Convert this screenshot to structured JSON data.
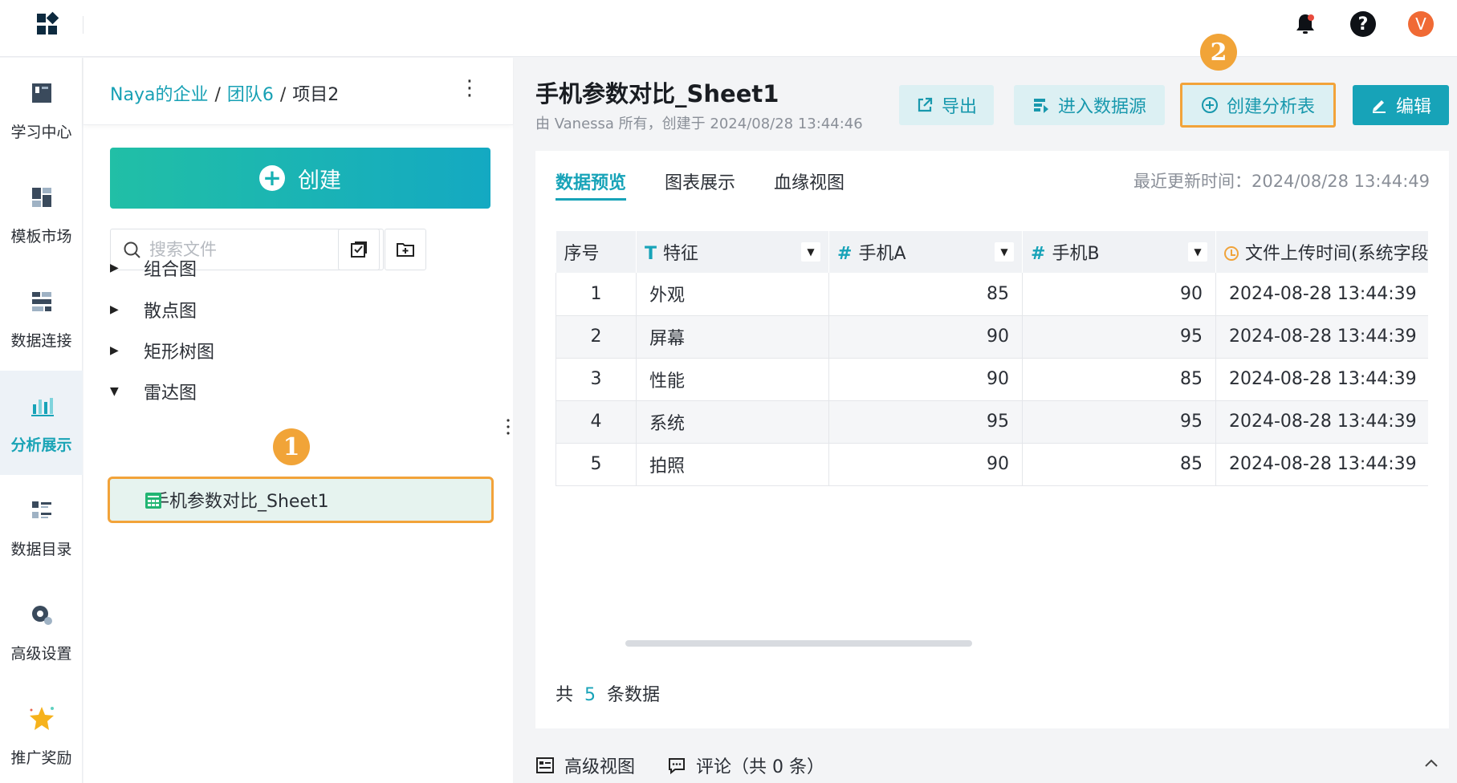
{
  "nav": {
    "items": [
      {
        "label": "学习中心",
        "icon": "book-icon"
      },
      {
        "label": "模板市场",
        "icon": "template-grid-icon"
      },
      {
        "label": "数据连接",
        "icon": "data-connect-icon"
      },
      {
        "label": "分析展示",
        "icon": "bar-chart-icon"
      },
      {
        "label": "数据目录",
        "icon": "catalog-icon"
      },
      {
        "label": "高级设置",
        "icon": "gear-icon"
      },
      {
        "label": "推广奖励",
        "icon": "star-icon"
      }
    ],
    "active": "分析展示"
  },
  "topbar": {
    "avatar_letter": "V"
  },
  "explorer": {
    "breadcrumb": [
      {
        "label": "Naya的企业"
      },
      {
        "label": "团队6"
      },
      {
        "label": "项目2"
      }
    ],
    "separator": "/",
    "more": "⋮",
    "create_label": "创建",
    "search_placeholder": "搜索文件",
    "tree": [
      {
        "label": "组合图",
        "arrow": "▶"
      },
      {
        "label": "散点图",
        "arrow": "▶"
      },
      {
        "label": "矩形树图",
        "arrow": "▶"
      },
      {
        "label": "雷达图",
        "arrow": "▼"
      }
    ],
    "selected_file": "手机参数对比_Sheet1",
    "badge1": "1"
  },
  "main": {
    "title": "手机参数对比_Sheet1",
    "subtitle": "由 Vanessa 所有，创建于 2024/08/28 13:44:46",
    "actions": {
      "export": "导出",
      "source": "进入数据源",
      "create_analysis": "创建分析表",
      "edit": "编辑"
    },
    "badge2": "2",
    "tabs": [
      "数据预览",
      "图表展示",
      "血缘视图"
    ],
    "updated": "最近更新时间：2024/08/28 13:44:49",
    "table": {
      "headers": [
        "序号",
        "特征",
        "手机A",
        "手机B",
        "文件上传时间(系统字段)"
      ],
      "header_type_icons": [
        "",
        "T",
        "#",
        "#",
        "clock"
      ],
      "rows": [
        [
          "1",
          "外观",
          "85",
          "90",
          "2024-08-28 13:44:39"
        ],
        [
          "2",
          "屏幕",
          "90",
          "95",
          "2024-08-28 13:44:39"
        ],
        [
          "3",
          "性能",
          "90",
          "85",
          "2024-08-28 13:44:39"
        ],
        [
          "4",
          "系统",
          "95",
          "95",
          "2024-08-28 13:44:39"
        ],
        [
          "5",
          "拍照",
          "90",
          "85",
          "2024-08-28 13:44:39"
        ]
      ]
    },
    "count": {
      "prefix": "共",
      "n": "5",
      "suffix": "条数据"
    },
    "bottom": {
      "advanced_view": "高级视图",
      "comment": "评论（共 0 条）"
    }
  },
  "colors": {
    "accent": "#17a3b8",
    "highlight": "#f2a33a",
    "avatar": "#f06a35"
  }
}
